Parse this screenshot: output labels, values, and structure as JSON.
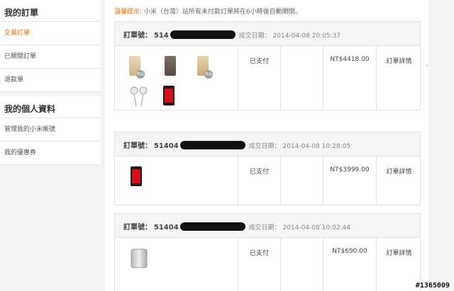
{
  "sidebar": {
    "orders_heading": "我的訂單",
    "order_items": [
      {
        "label": "交易訂單",
        "active": true
      },
      {
        "label": "已關閉訂單",
        "active": false
      },
      {
        "label": "退款單",
        "active": false
      }
    ],
    "profile_heading": "我的個人資料",
    "profile_items": [
      {
        "label": "管理我的小米帳號"
      },
      {
        "label": "我的優惠券"
      }
    ]
  },
  "tip": {
    "label": "溫馨提示:",
    "text": "小米（台灣）站所有未付款訂單將在6小時後自動關閉。"
  },
  "orders": [
    {
      "no_label": "訂單號：",
      "no_prefix": "514",
      "date_label": "成交日期：",
      "date": "2014-04-08 20:05:37",
      "status": "已支付",
      "amount": "NT$4418.00",
      "detail": "訂單詳情",
      "badges": [
        "贈品",
        "贈品"
      ]
    },
    {
      "no_label": "訂單號：",
      "no_prefix": "51404",
      "date_label": "成交日期：",
      "date": "2014-04-08 10:28:05",
      "status": "已支付",
      "amount": "NT$3999.00",
      "detail": "訂單詳情"
    },
    {
      "no_label": "訂單號：",
      "no_prefix": "51404",
      "date_label": "成交日期：",
      "date": "2014-04-08 10:02:44",
      "status": "已支付",
      "amount": "NT$690.00",
      "detail": "訂單詳情"
    }
  ],
  "watermark": "#1365009",
  "colors": {
    "accent": "#ff6700",
    "phone_screen": "#d6101a"
  }
}
